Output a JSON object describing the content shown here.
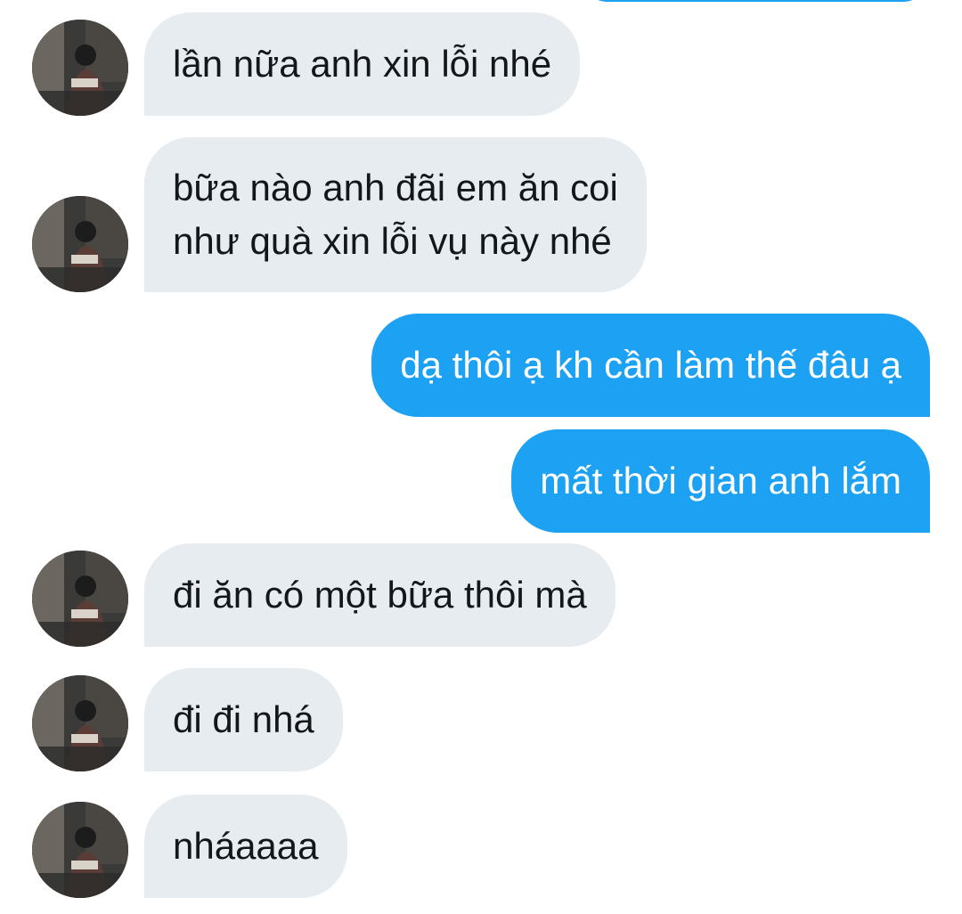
{
  "colors": {
    "incoming_bubble": "#e6ecf0",
    "outgoing_bubble": "#1da1f2",
    "incoming_text": "#14171a",
    "outgoing_text": "#ffffff"
  },
  "contact": {
    "avatar_icon": "profile-photo-avatar"
  },
  "messages": [
    {
      "direction": "incoming",
      "lines": [
        "lần nữa anh xin lỗi nhé"
      ]
    },
    {
      "direction": "incoming",
      "lines": [
        "bữa nào anh đãi em ăn coi",
        "như quà xin lỗi vụ này nhé"
      ]
    },
    {
      "direction": "outgoing",
      "lines": [
        "dạ thôi ạ kh cần làm thế đâu ạ"
      ]
    },
    {
      "direction": "outgoing",
      "lines": [
        "mất thời gian anh lắm"
      ]
    },
    {
      "direction": "incoming",
      "lines": [
        "đi ăn có một bữa thôi mà"
      ]
    },
    {
      "direction": "incoming",
      "lines": [
        "đi đi nhá"
      ]
    },
    {
      "direction": "incoming",
      "lines": [
        "nháaaaa"
      ]
    }
  ]
}
